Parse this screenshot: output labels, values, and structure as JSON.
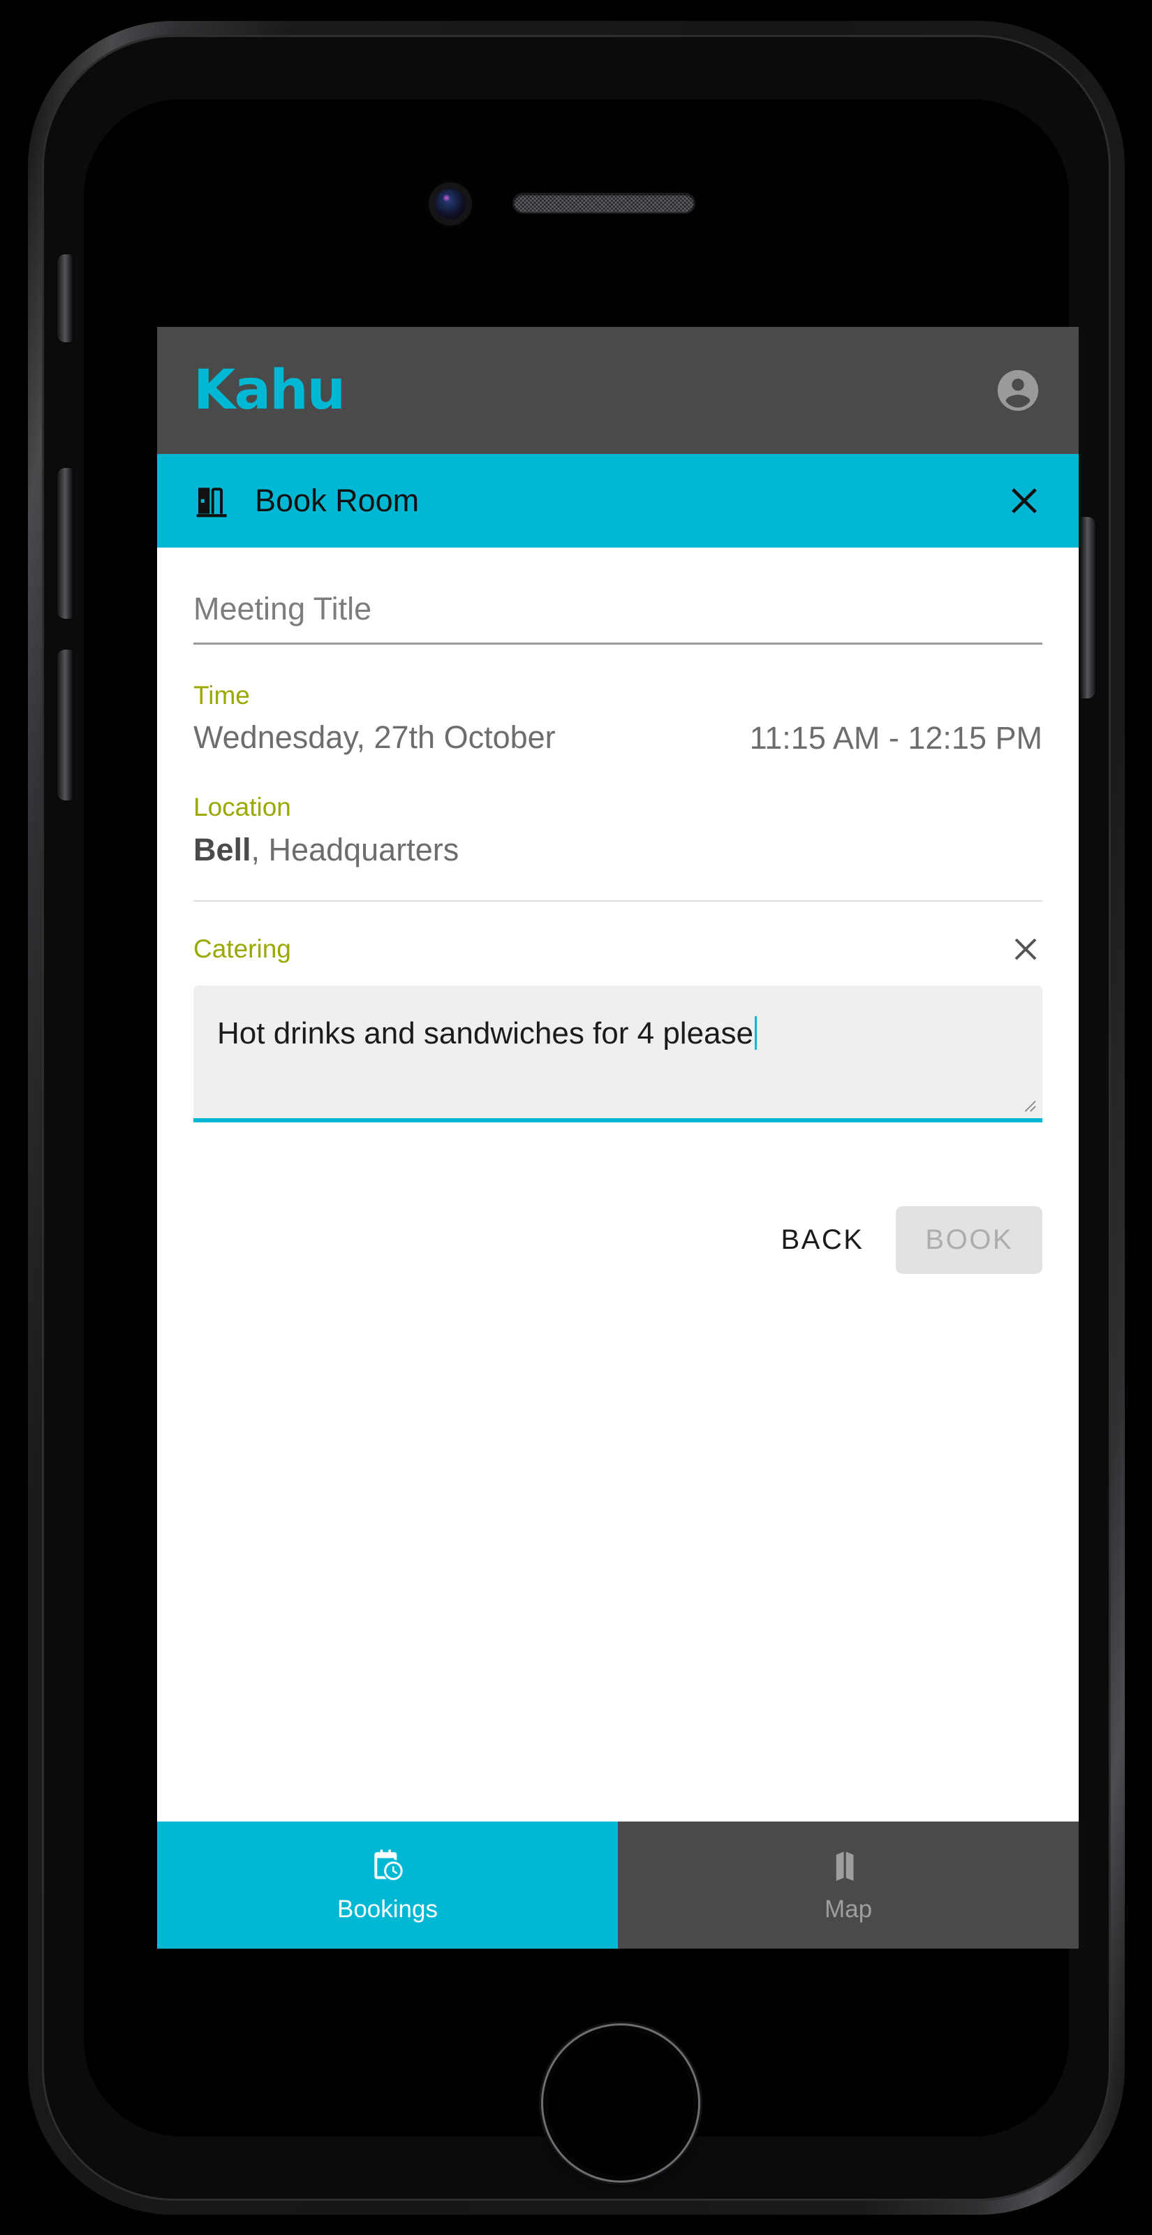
{
  "colors": {
    "accent_cyan": "#00b8d4",
    "header_gray": "#4a4a4a",
    "label_olive": "#9aa800",
    "body_text_gray": "#6d6d6d",
    "disabled_button_bg": "#e2e2e2",
    "disabled_button_text": "#adadad",
    "textarea_bg": "#efefef"
  },
  "appbar": {
    "logo": "Kahu",
    "account_icon": "account-circle-icon"
  },
  "titlebar": {
    "icon": "meeting-room-door-icon",
    "title": "Book Room",
    "close_icon": "close-x-icon"
  },
  "form": {
    "meeting_title": {
      "placeholder": "Meeting Title",
      "value": ""
    },
    "time": {
      "label": "Time",
      "date": "Wednesday, 27th October",
      "range": "11:15 AM - 12:15 PM"
    },
    "location": {
      "label": "Location",
      "room": "Bell",
      "separator": ", ",
      "building": "Headquarters"
    },
    "catering": {
      "label": "Catering",
      "remove_icon": "close-x-icon",
      "value": "Hot drinks and sandwiches for 4 please",
      "placeholder": "",
      "resize_handle": "resize-grip-icon"
    }
  },
  "actions": {
    "back_label": "BACK",
    "book_label": "BOOK",
    "book_disabled": true
  },
  "navbar": {
    "items": [
      {
        "label": "Bookings",
        "icon": "calendar-clock-icon",
        "active": true
      },
      {
        "label": "Map",
        "icon": "folded-map-icon",
        "active": false
      }
    ]
  },
  "device": {
    "camera": "front-camera",
    "speaker": "earpiece-speaker",
    "home_button": "home-button",
    "buttons": [
      "mute-switch",
      "volume-up-button",
      "volume-down-button",
      "power-button"
    ]
  }
}
